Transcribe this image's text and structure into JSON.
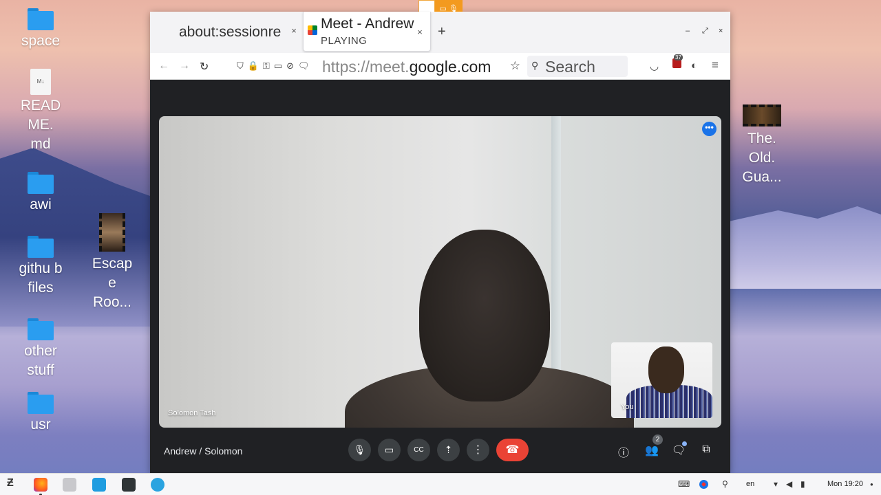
{
  "desktop": {
    "icons": [
      {
        "label": "space"
      },
      {
        "label": "READ ME. md",
        "doc_tag": "M↓"
      },
      {
        "label": "awi"
      },
      {
        "label": "githu b files"
      },
      {
        "label": "other stuff"
      },
      {
        "label": "usr"
      },
      {
        "label": "Escap e Roo..."
      },
      {
        "label": "The. Old. Gua..."
      }
    ]
  },
  "browser": {
    "tabs": [
      {
        "title": "about:sessionrestore",
        "close": "×"
      },
      {
        "title": "Meet - Andrew",
        "status": "PLAYING",
        "close": "×"
      }
    ],
    "new_tab": "+",
    "window_controls": [
      "–",
      "⤢",
      "×"
    ],
    "nav": {
      "back": "←",
      "forward": "→",
      "reload": "↻"
    },
    "url_prefix": "https://meet.",
    "url_domain": "google.com",
    "star": "☆",
    "search_placeholder": "Search",
    "menu": "≡",
    "badge_count": "37"
  },
  "meet": {
    "main_participant": "Solomon Tash",
    "self_label": "You",
    "meeting_name": "Andrew / Solomon",
    "more_label": "•••",
    "people_count": "2",
    "end_call_glyph": "☎",
    "controls": [
      "mic",
      "camera",
      "captions",
      "present",
      "more-options"
    ]
  },
  "taskbar": {
    "keyboard_lang": "en",
    "clock": "Mon 19:20"
  },
  "colors": {
    "end_call": "#ea4335",
    "meet_bg": "#202124",
    "accent_blue": "#1a73e8",
    "folder_blue": "#2a9df0"
  }
}
